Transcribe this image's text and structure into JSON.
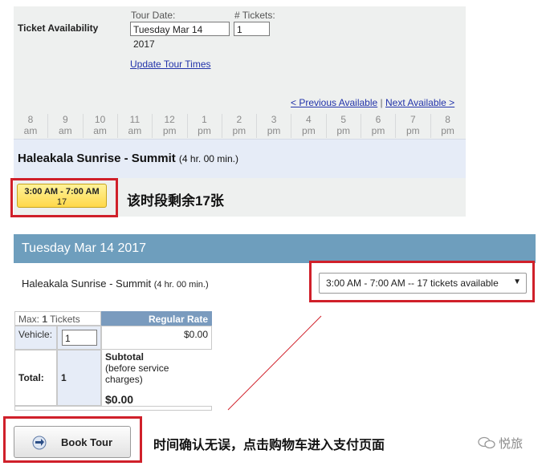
{
  "availability": {
    "title": "Ticket Availability",
    "tour_date_label": "Tour Date:",
    "tour_date_value": "Tuesday Mar 14 2017",
    "tickets_label": "# Tickets:",
    "tickets_value": "1",
    "update_link": "Update Tour Times",
    "prev_link": "< Previous Available",
    "separator": "|",
    "next_link": "Next Available >",
    "hours": [
      {
        "h": "8",
        "p": "am"
      },
      {
        "h": "9",
        "p": "am"
      },
      {
        "h": "10",
        "p": "am"
      },
      {
        "h": "11",
        "p": "am"
      },
      {
        "h": "12",
        "p": "pm"
      },
      {
        "h": "1",
        "p": "pm"
      },
      {
        "h": "2",
        "p": "pm"
      },
      {
        "h": "3",
        "p": "pm"
      },
      {
        "h": "4",
        "p": "pm"
      },
      {
        "h": "5",
        "p": "pm"
      },
      {
        "h": "6",
        "p": "pm"
      },
      {
        "h": "7",
        "p": "pm"
      },
      {
        "h": "8",
        "p": "pm"
      }
    ],
    "tour_name": "Haleakala Sunrise - Summit",
    "tour_duration": "(4 hr. 00 min.)",
    "slot_time": "3:00 AM - 7:00 AM",
    "slot_count": "17",
    "annotation_slot": "该时段剩余17张"
  },
  "booking": {
    "date_header": "Tuesday Mar 14 2017",
    "tour_name": "Haleakala Sunrise - Summit",
    "tour_duration": "(4 hr. 00 min.)",
    "time_select_value": "3:00 AM - 7:00 AM -- 17 tickets available",
    "max_prefix": "Max:",
    "max_value": "1",
    "max_suffix": "Tickets",
    "rate_header": "Regular Rate",
    "vehicle_label": "Vehicle:",
    "vehicle_value": "1",
    "vehicle_price": "$0.00",
    "total_label": "Total:",
    "total_qty": "1",
    "subtotal_label": "Subtotal",
    "subtotal_note": "(before service charges)",
    "subtotal_value": "$0.00",
    "book_button": "Book Tour",
    "annotation_book": "时间确认无误，点击购物车进入支付页面"
  },
  "watermark": {
    "text": "悦旅",
    "logo_icon": "wechat-bubble-icon"
  },
  "colors": {
    "header_blue": "#6e9ebd",
    "highlight_red": "#d0202a",
    "slot_yellow": "#ffd84a"
  }
}
